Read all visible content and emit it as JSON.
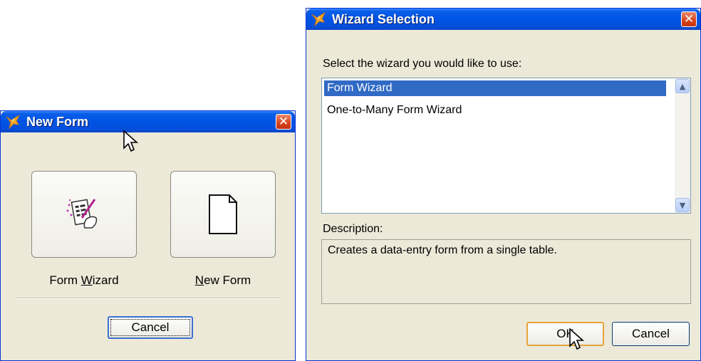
{
  "new_form_dialog": {
    "title": "New Form",
    "close_glyph": "✕",
    "form_wizard_label_pre": "Form ",
    "form_wizard_label_accel": "W",
    "form_wizard_label_post": "izard",
    "new_form_label_accel": "N",
    "new_form_label_post": "ew Form",
    "cancel_label": "Cancel"
  },
  "wizard_dialog": {
    "title": "Wizard Selection",
    "close_glyph": "✕",
    "prompt": "Select the wizard you would like to use:",
    "items": [
      {
        "label": "Form Wizard",
        "selected": true
      },
      {
        "label": "One-to-Many Form Wizard",
        "selected": false
      }
    ],
    "scroll_up_glyph": "▲",
    "scroll_down_glyph": "▼",
    "description_label": "Description:",
    "description": "Creates a data-entry form from a single table.",
    "ok_label": "OK",
    "cancel_label": "Cancel"
  },
  "colors": {
    "titlebar": "#0055e5",
    "dialog_face": "#ece9d8",
    "selection": "#316ac5",
    "close_button": "#d8431b"
  },
  "icons": [
    "fox-icon",
    "close-icon",
    "form-wizard-icon",
    "blank-document-icon",
    "scroll-up-icon",
    "scroll-down-icon",
    "mouse-cursor-icon"
  ]
}
